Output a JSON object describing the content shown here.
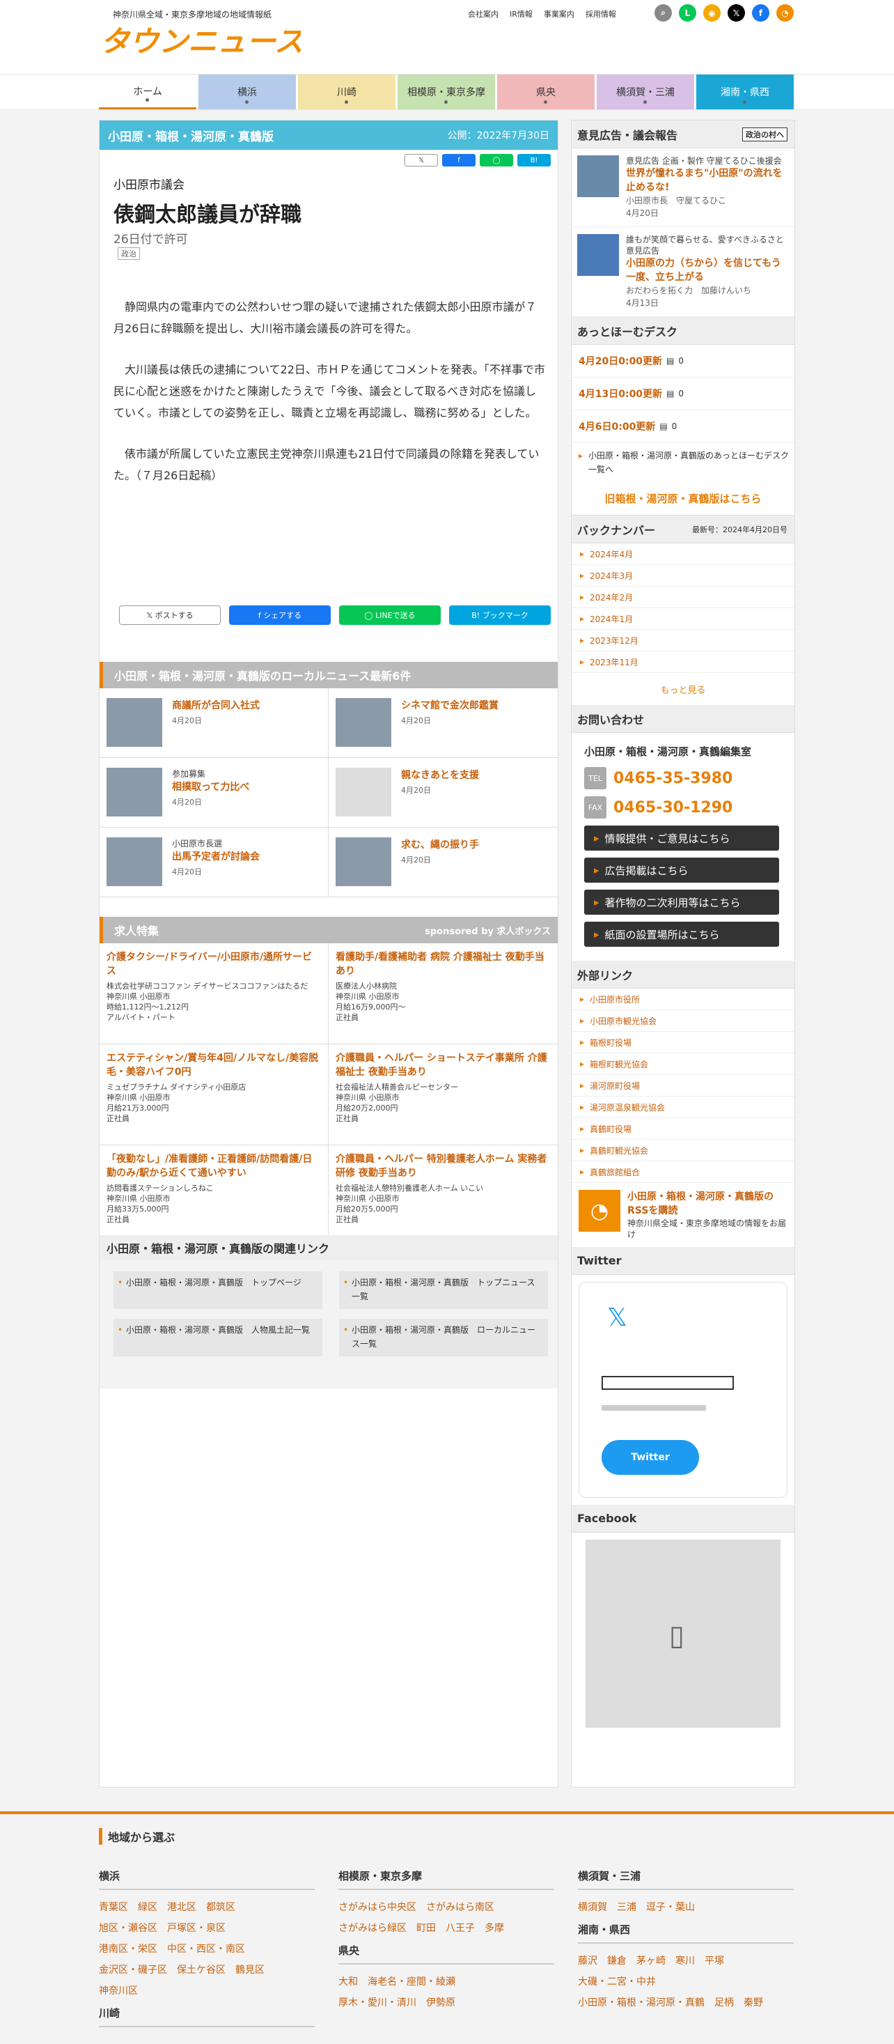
{
  "header": {
    "tagline": "神奈川県全域・東京多摩地域の地域情報紙",
    "logo": "タウンニュース",
    "links": [
      "会社案内",
      "IR情報",
      "事業案内",
      "採用情報"
    ]
  },
  "nav": [
    "ホーム",
    "横浜",
    "川崎",
    "相模原・東京多摩",
    "県央",
    "横須賀・三浦",
    "湘南・県西"
  ],
  "nav_colors": [
    "#ffffff",
    "#b4cbec",
    "#f4e3a6",
    "#c6e2b0",
    "#f0b8b8",
    "#d8c0e6",
    "#1aa7d6"
  ],
  "article": {
    "edition": "小田原・箱根・湯河原・真鶴版",
    "published": "公開：2022年7月30日",
    "kicker": "小田原市議会",
    "title": "俵鋼太郎議員が辞職",
    "subtitle": "26日付で許可",
    "tag": "政治",
    "paragraphs": [
      "静岡県内の電車内での公然わいせつ罪の疑いで逮捕された俵鋼太郎小田原市議が７月26日に辞職願を提出し、大川裕市議会議長の許可を得た。",
      "大川議長は俵氏の逮捕について22日、市ＨＰを通じてコメントを発表。「不祥事で市民に心配と迷惑をかけたと陳謝したうえで「今後、議会として取るべき対応を協議していく。市議としての姿勢を正し、職責と立場を再認識し、職務に努める」とした。",
      "俵市議が所属していた立憲民主党神奈川県連も21日付で同議員の除籍を発表していた。（７月26日起稿）"
    ],
    "share": {
      "x": "ポストする",
      "fb": "シェアする",
      "line": "LINEで送る",
      "hb": "ブックマーク"
    }
  },
  "local_news": {
    "heading": "小田原・箱根・湯河原・真鶴版のローカルニュース最新6件",
    "items": [
      {
        "kicker": "",
        "title": "商議所が合同入社式",
        "date": "4月20日"
      },
      {
        "kicker": "",
        "title": "シネマ館で金次郎鑑賞",
        "date": "4月20日"
      },
      {
        "kicker": "参加募集",
        "title": "相撲取って力比べ",
        "date": "4月20日"
      },
      {
        "kicker": "",
        "title": "親なきあとを支援",
        "date": "4月20日"
      },
      {
        "kicker": "小田原市長選",
        "title": "出馬予定者が討論会",
        "date": "4月20日"
      },
      {
        "kicker": "",
        "title": "求む、縄の振り手",
        "date": "4月20日"
      }
    ]
  },
  "jobs": {
    "heading": "求人特集",
    "sponsor": "sponsored by 求人ボックス",
    "items": [
      {
        "title": "介護タクシー/ドライバー/小田原市/通所サービス",
        "company": "株式会社学研ココファン デイサービスココファンはたるだ",
        "place": "神奈川県 小田原市",
        "pay": "時給1,112円〜1,212円",
        "type": "アルバイト・パート"
      },
      {
        "title": "看護助手/看護補助者 病院 介護福祉士 夜勤手当あり",
        "company": "医療法人小林病院",
        "place": "神奈川県 小田原市",
        "pay": "月給16万9,000円〜",
        "type": "正社員"
      },
      {
        "title": "エステティシャン/賞与年4回/ノルマなし/美容脱毛・美容ハイフ0円",
        "company": "ミュゼプラチナム ダイナシティ小田原店",
        "place": "神奈川県 小田原市",
        "pay": "月給21万3,000円",
        "type": "正社員"
      },
      {
        "title": "介護職員・ヘルパー ショートステイ事業所 介護福祉士 夜勤手当あり",
        "company": "社会福祉法人精善会ルピーセンター",
        "place": "神奈川県 小田原市",
        "pay": "月給20万2,000円",
        "type": "正社員"
      },
      {
        "title": "「夜勤なし」/准看護師・正看護師/訪問看護/日勤のみ/駅から近くて通いやすい",
        "company": "訪問看護ステーションしろねこ",
        "place": "神奈川県 小田原市",
        "pay": "月給33万5,000円",
        "type": "正社員"
      },
      {
        "title": "介護職員・ヘルパー 特別養護老人ホーム 実務者研修 夜勤手当あり",
        "company": "社会福祉法人憩特別養護老人ホーム いこい",
        "place": "神奈川県 小田原市",
        "pay": "月給20万5,000円",
        "type": "正社員"
      }
    ]
  },
  "related": {
    "heading": "小田原・箱根・湯河原・真鶴版の関連リンク",
    "links": [
      "小田原・箱根・湯河原・真鶴版　トップページ",
      "小田原・箱根・湯河原・真鶴版　トップニュース一覧",
      "小田原・箱根・湯河原・真鶴版　人物風土記一覧",
      "小田原・箱根・湯河原・真鶴版　ローカルニュース一覧"
    ]
  },
  "sidebar": {
    "ads_heading": "意見広告・議会報告",
    "ads_badge": "政治の村へ",
    "ads": [
      {
        "kicker": "意見広告 企画・製作 守屋てるひこ後援会",
        "title": "世界が憧れるまち\"小田原\"の流れを止めるな!",
        "meta": "小田原市長　守屋てるひこ",
        "date": "4月20日"
      },
      {
        "kicker": "誰もが笑顔で暮らせる、愛すべきふるさと 意見広告",
        "title": "小田原の力（ちから）を信じてもう一度、立ち上がる",
        "meta": "おだわらを拓く力　加藤けんいち",
        "date": "4月13日"
      }
    ],
    "desk_heading": "あっとほーむデスク",
    "desk": [
      {
        "label": "4月20日0:00更新",
        "count": "0"
      },
      {
        "label": "4月13日0:00更新",
        "count": "0"
      },
      {
        "label": "4月6日0:00更新",
        "count": "0"
      }
    ],
    "desk_link": "小田原・箱根・湯河原・真鶴版のあっとほーむデスク一覧へ",
    "old_edition": "旧箱根・湯河原・真鶴版はこちら",
    "backnumber_heading": "バックナンバー",
    "backnumber_latest": "最新号：2024年4月20日号",
    "backnumbers": [
      "2024年4月",
      "2024年3月",
      "2024年2月",
      "2024年1月",
      "2023年12月",
      "2023年11月"
    ],
    "more": "もっと見る",
    "contact_heading": "お問い合わせ",
    "contact_office": "小田原・箱根・湯河原・真鶴編集室",
    "tel_label": "TEL",
    "tel": "0465-35-3980",
    "fax_label": "FAX",
    "fax": "0465-30-1290",
    "buttons": [
      "情報提供・ご意見はこちら",
      "広告掲載はこちら",
      "著作物の二次利用等はこちら",
      "紙面の設置場所はこちら"
    ],
    "external_heading": "外部リンク",
    "external": [
      "小田原市役所",
      "小田原市観光協会",
      "箱根町役場",
      "箱根町観光協会",
      "湯河原町役場",
      "湯河原温泉観光協会",
      "真鶴町役場",
      "真鶴町観光協会",
      "真鶴旅館組合"
    ],
    "rss_title": "小田原・箱根・湯河原・真鶴版のRSSを購読",
    "rss_desc": "神奈川県全域・東京多摩地域の情報をお届け",
    "twitter_heading": "Twitter",
    "twitter_button": "Twitter",
    "facebook_heading": "Facebook"
  },
  "footer": {
    "heading": "地域から選ぶ",
    "cols": [
      {
        "title": "横浜",
        "links": [
          "青葉区　緑区　港北区　都筑区",
          "旭区・瀬谷区　戸塚区・泉区",
          "港南区・栄区　中区・西区・南区",
          "金沢区・磯子区　保土ケ谷区　鶴見区",
          "神奈川区"
        ],
        "title2": "川崎",
        "links2": []
      },
      {
        "title": "相模原・東京多摩",
        "links": [
          "さがみはら中央区　さがみはら南区",
          "さがみはら緑区　町田　八王子　多摩"
        ],
        "title2": "県央",
        "links2": [
          "大和　海老名・座間・綾瀬",
          "厚木・愛川・清川　伊勢原"
        ]
      },
      {
        "title": "横須賀・三浦",
        "links": [
          "横須賀　三浦　逗子・葉山"
        ],
        "title2": "湘南・県西",
        "links2": [
          "藤沢　鎌倉　茅ヶ崎　寒川　平塚",
          "大磯・二宮・中井",
          "小田原・箱根・湯河原・真鶴　足柄　秦野"
        ]
      }
    ]
  }
}
